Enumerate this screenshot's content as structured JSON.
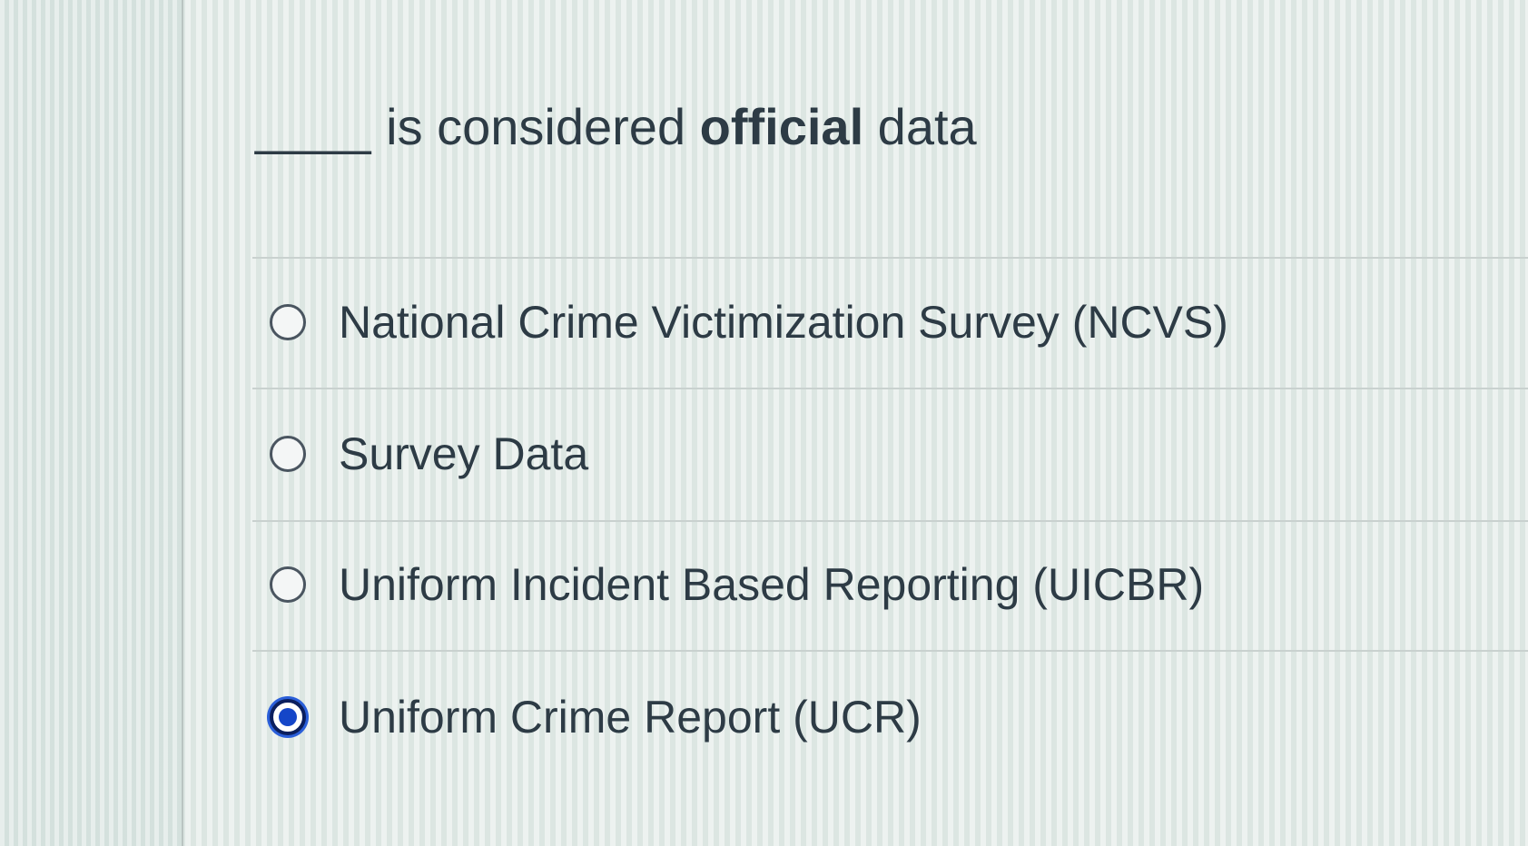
{
  "question": {
    "blank": "____",
    "text_before": " is considered ",
    "text_emphasis": "official",
    "text_after": " data"
  },
  "answers": [
    {
      "label": "National Crime Victimization Survey (NCVS)",
      "selected": false
    },
    {
      "label": "Survey Data",
      "selected": false
    },
    {
      "label": "Uniform Incident Based Reporting (UICBR)",
      "selected": false
    },
    {
      "label": "Uniform Crime Report (UCR)",
      "selected": true
    }
  ],
  "colors": {
    "text": "#2d3b45",
    "selected_radio": "#1546c8",
    "divider": "#c9d1cf"
  }
}
